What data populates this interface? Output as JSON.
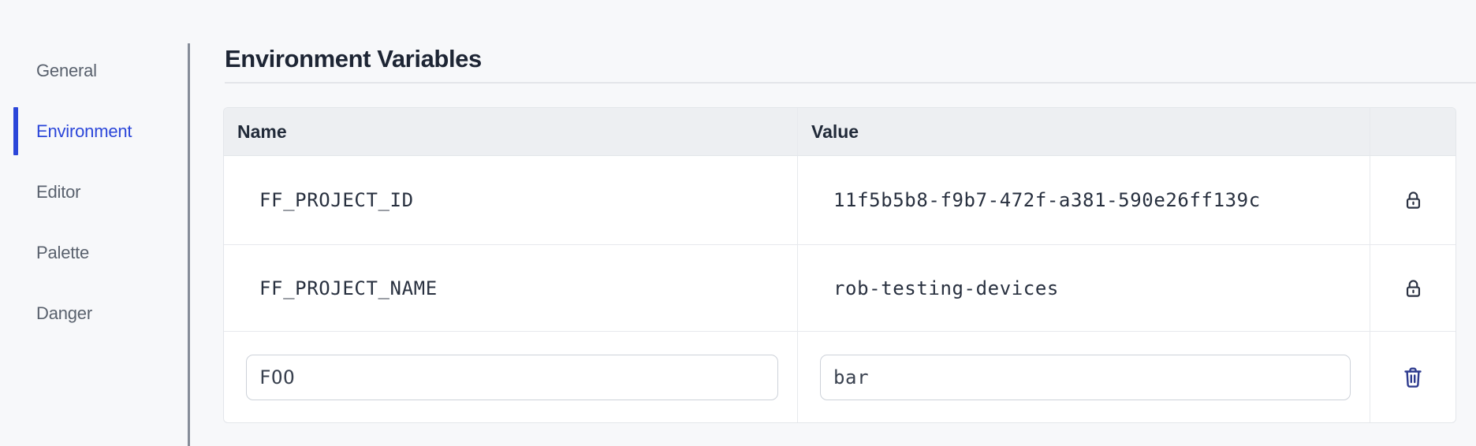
{
  "sidebar": {
    "items": [
      {
        "label": "General",
        "active": false
      },
      {
        "label": "Environment",
        "active": true
      },
      {
        "label": "Editor",
        "active": false
      },
      {
        "label": "Palette",
        "active": false
      },
      {
        "label": "Danger",
        "active": false
      }
    ]
  },
  "main": {
    "title": "Environment Variables",
    "table": {
      "headers": {
        "name": "Name",
        "value": "Value",
        "actions": ""
      },
      "rows": [
        {
          "name": "FF_PROJECT_ID",
          "value": "11f5b5b8-f9b7-472f-a381-590e26ff139c",
          "locked": true
        },
        {
          "name": "FF_PROJECT_NAME",
          "value": "rob-testing-devices",
          "locked": true
        }
      ],
      "new_row": {
        "name_input": {
          "value": "FOO"
        },
        "value_input": {
          "value": "bar"
        }
      }
    }
  },
  "icons": {
    "lock": "lock-icon",
    "trash": "trash-icon"
  },
  "colors": {
    "accent_blue": "#2b46d9",
    "lock_icon_navy": "#2a3142",
    "trash_icon_blue": "#2d3a8e",
    "page_background": "#f7f8fa",
    "table_header_background": "#edeff2"
  }
}
